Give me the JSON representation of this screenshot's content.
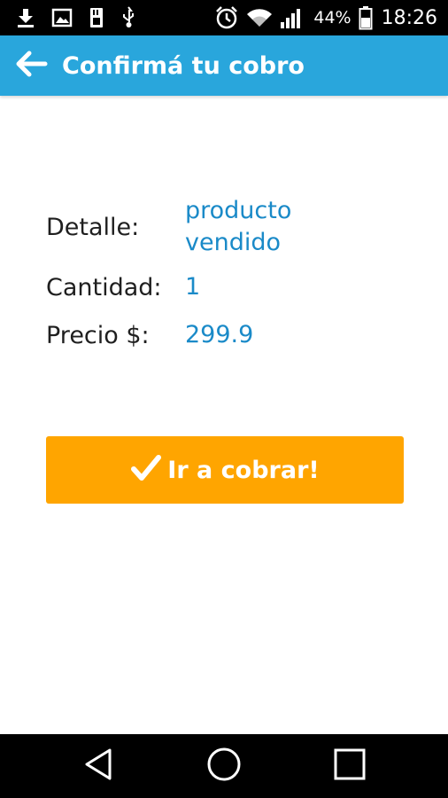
{
  "status_bar": {
    "left_icons": [
      "download-icon",
      "image-icon",
      "sd-card-icon",
      "usb-icon"
    ],
    "right_icons": [
      "alarm-icon",
      "wifi-icon",
      "signal-icon",
      "battery-icon"
    ],
    "battery_percent": "44%",
    "time": "18:26"
  },
  "app_bar": {
    "back_icon": "arrow-left-icon",
    "title": "Confirmá tu cobro",
    "color": "#29a6dc"
  },
  "details": {
    "detalle_label": "Detalle:",
    "detalle_value_line1": "producto",
    "detalle_value_line2": "vendido",
    "cantidad_label": "Cantidad:",
    "cantidad_value": "1",
    "precio_label": "Precio $:",
    "precio_value": "299.9",
    "value_color": "#1a8ac8"
  },
  "action": {
    "label": "Ir a cobrar!",
    "icon": "check-icon",
    "color": "#ffa500"
  },
  "nav_bar": {
    "buttons": [
      "back-triangle-icon",
      "home-circle-icon",
      "recents-square-icon"
    ]
  }
}
